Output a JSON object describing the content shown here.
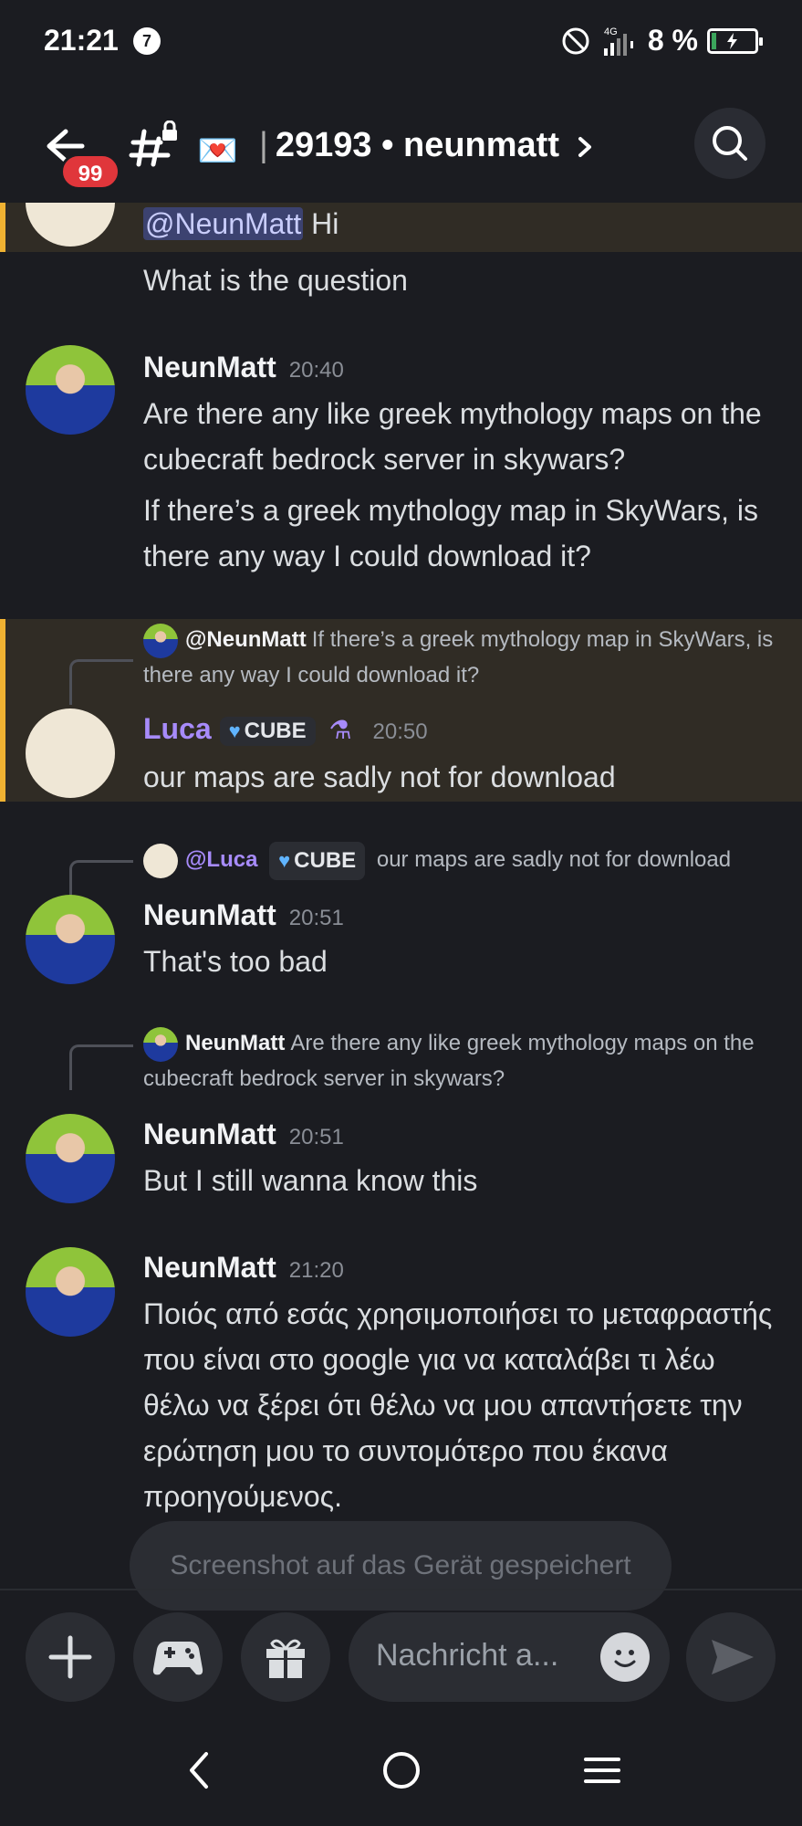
{
  "status_bar": {
    "time": "21:21",
    "notification_count": "7",
    "network": "4G",
    "battery": "8 %"
  },
  "header": {
    "unread_badge": "99",
    "channel_name": "29193",
    "separator": "•",
    "channel_sub": "neunmatt",
    "envelope_emoji": "💌"
  },
  "messages": [
    {
      "kind": "continuation",
      "mention": "@NeunMatt",
      "text": "Hi"
    },
    {
      "kind": "continuation",
      "text": "What is the question"
    },
    {
      "author": "NeunMatt",
      "time": "20:40",
      "lines": [
        "Are there any like greek mythology maps on the cubecraft bedrock server in skywars?",
        "If there’s a greek mythology map in SkyWars, is there any way I could download it?"
      ]
    },
    {
      "author": "Luca",
      "time": "20:50",
      "tag": "CUBE",
      "reply_to": {
        "name": "@NeunMatt",
        "text": "If there’s a greek mythology map in SkyWars, is there any way I could download it?"
      },
      "text": "our maps are sadly not for download"
    },
    {
      "author": "NeunMatt",
      "time": "20:51",
      "reply_to": {
        "name": "@Luca",
        "tag": "CUBE",
        "text": "our maps are sadly not for download"
      },
      "text": "That's too bad"
    },
    {
      "author": "NeunMatt",
      "time": "20:51",
      "reply_to": {
        "name": "NeunMatt",
        "text": "Are there any like greek mythology maps on the cubecraft bedrock server in skywars?"
      },
      "text": "But I still wanna know this"
    },
    {
      "author": "NeunMatt",
      "time": "21:20",
      "text": "Ποιός από εσάς χρησιμοποιήσει το μεταφραστής που είναι στο google για να καταλάβει τι λέω θέλω να ξέρει ότι θέλω να μου απαντήσετε την ερώτηση μου το συντομότερο που έκανα προηγούμενος."
    }
  ],
  "toast": "Screenshot auf das Gerät gespeichert",
  "composer": {
    "placeholder": "Nachricht a..."
  },
  "icons": [
    "back-arrow-icon",
    "channel-hash-icon",
    "search-icon",
    "plus-icon",
    "gamepad-icon",
    "gift-icon",
    "emoji-icon",
    "send-icon",
    "nav-back-icon",
    "nav-home-icon",
    "nav-menu-icon"
  ],
  "colors": {
    "background": "#1b1c21",
    "highlight": "#302c25",
    "highlight_border": "#f0b232",
    "badge": "#e0363b",
    "luca_name": "#a78bfa"
  }
}
